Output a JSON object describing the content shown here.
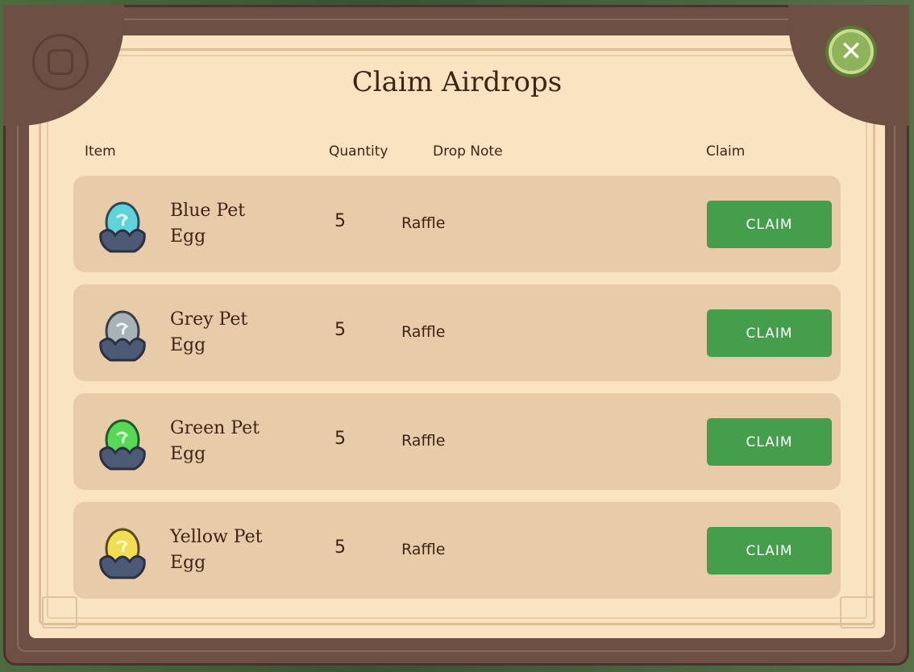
{
  "dialog": {
    "title": "Claim Airdrops",
    "close_icon": "x-icon",
    "accent_color": "#449e4c"
  },
  "columns": {
    "item": "Item",
    "quantity": "Quantity",
    "drop_note": "Drop Note",
    "claim": "Claim"
  },
  "rows": [
    {
      "name": "Blue Pet Egg",
      "line1": "Blue Pet",
      "line2": "Egg",
      "quantity": "5",
      "note": "Raffle",
      "button": "CLAIM",
      "egg_color": "#5fd3dc",
      "icon": "blue-egg-icon"
    },
    {
      "name": "Grey Pet Egg",
      "line1": "Grey Pet",
      "line2": "Egg",
      "quantity": "5",
      "note": "Raffle",
      "button": "CLAIM",
      "egg_color": "#a8b3b8",
      "icon": "grey-egg-icon"
    },
    {
      "name": "Green Pet Egg",
      "line1": "Green Pet",
      "line2": "Egg",
      "quantity": "5",
      "note": "Raffle",
      "button": "CLAIM",
      "egg_color": "#58d856",
      "icon": "green-egg-icon"
    },
    {
      "name": "Yellow Pet Egg",
      "line1": "Yellow Pet",
      "line2": "Egg",
      "quantity": "5",
      "note": "Raffle",
      "button": "CLAIM",
      "egg_color": "#f2de55",
      "icon": "yellow-egg-icon"
    }
  ]
}
